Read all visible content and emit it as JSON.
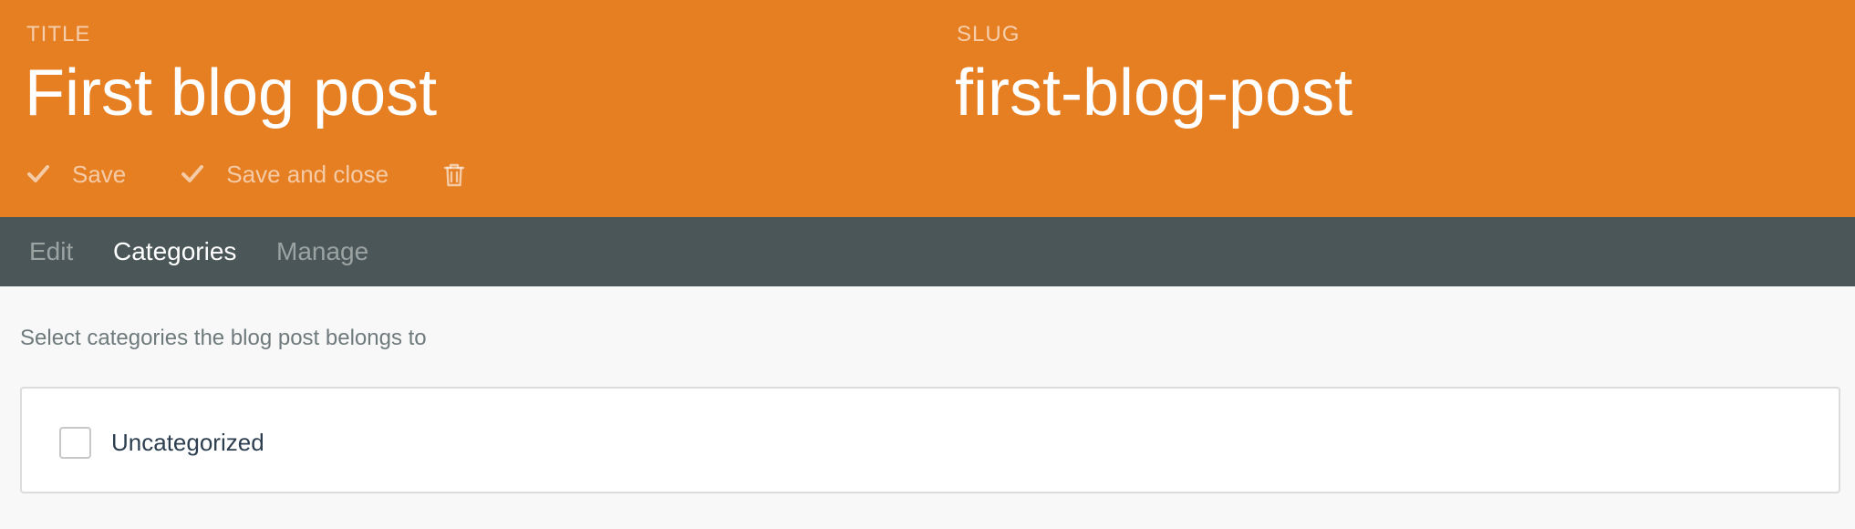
{
  "header": {
    "title_label": "TITLE",
    "title_value": "First blog post",
    "slug_label": "SLUG",
    "slug_value": "first-blog-post",
    "actions": {
      "save_label": "Save",
      "save_close_label": "Save and close",
      "delete_icon": "trash-icon"
    }
  },
  "tabs": [
    {
      "label": "Edit",
      "active": false
    },
    {
      "label": "Categories",
      "active": true
    },
    {
      "label": "Manage",
      "active": false
    }
  ],
  "main": {
    "help_text": "Select categories the blog post belongs to",
    "categories": [
      {
        "label": "Uncategorized",
        "checked": false
      }
    ]
  },
  "colors": {
    "header_bg": "#e67e22",
    "tabs_bg": "#4a5657",
    "page_bg": "#f8f8f8"
  }
}
